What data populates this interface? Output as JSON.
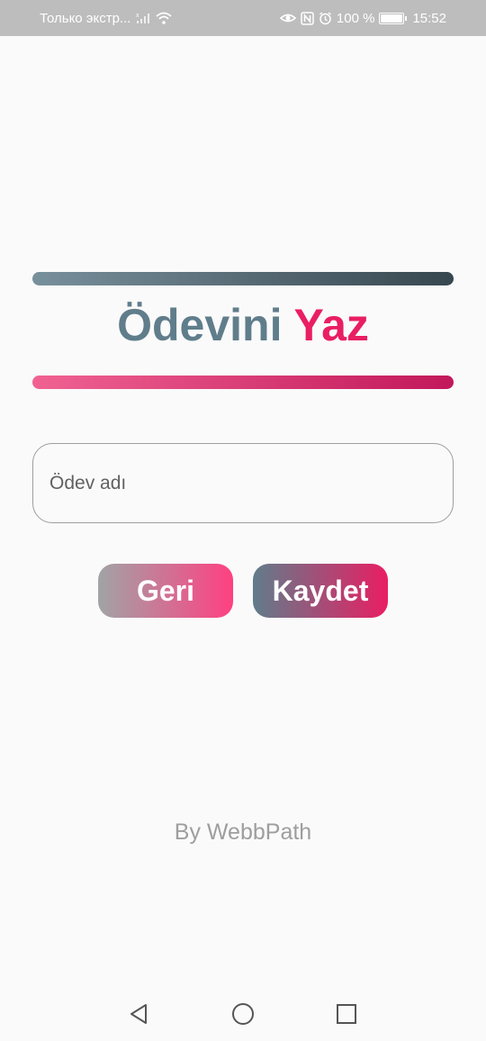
{
  "status_bar": {
    "carrier": "Только экстр...",
    "battery": "100 %",
    "time": "15:52",
    "icons": [
      "signal-off-icon",
      "wifi-icon",
      "eye-icon",
      "nfc-icon",
      "alarm-icon",
      "battery-icon"
    ]
  },
  "title": {
    "part1": "Ödevini",
    "part2": "Yaz"
  },
  "form": {
    "homework_placeholder": "Ödev adı"
  },
  "buttons": {
    "back": "Geri",
    "save": "Kaydet"
  },
  "footer": "By WebbPath",
  "colors": {
    "slate": "#607d8b",
    "pink": "#e91e63",
    "top_bar_gradient": [
      "#78909c",
      "#37474f"
    ],
    "bottom_bar_gradient": [
      "#f06292",
      "#c2185b"
    ]
  },
  "nav": {
    "icons": [
      "back-triangle-icon",
      "home-circle-icon",
      "recents-square-icon"
    ]
  }
}
